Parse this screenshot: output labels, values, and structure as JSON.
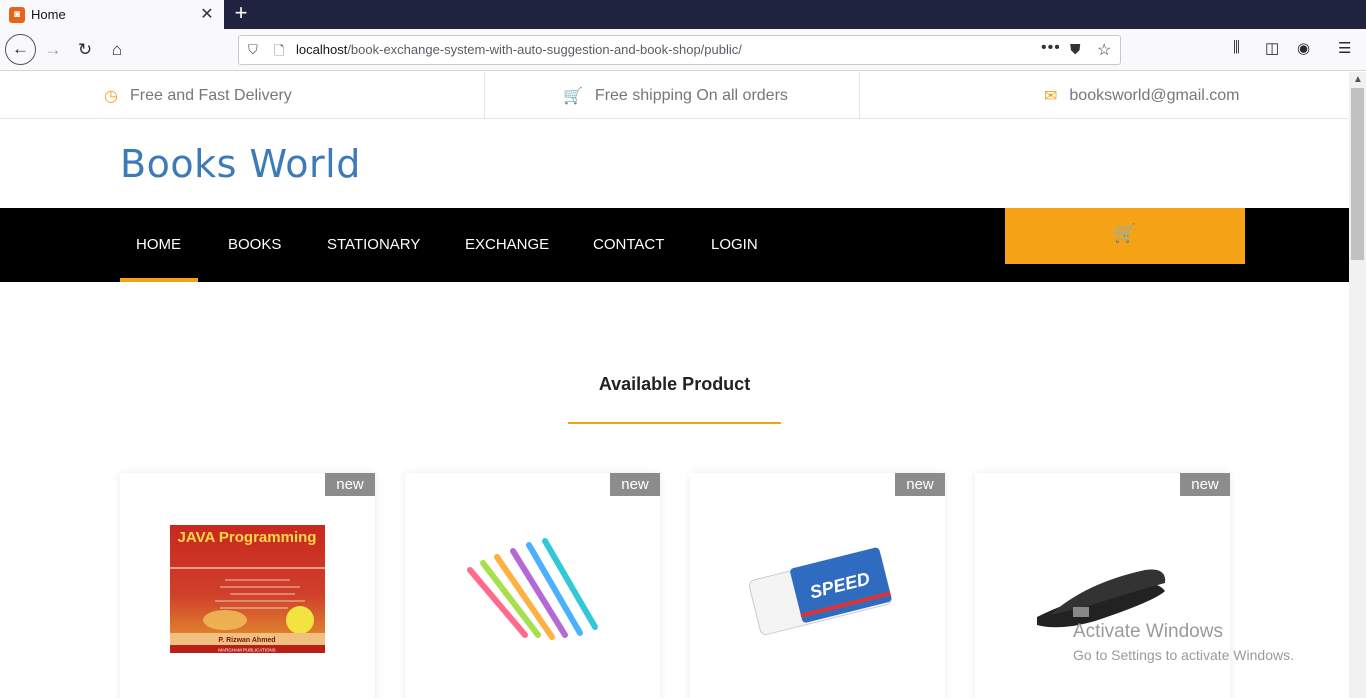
{
  "browser": {
    "tab_title": "Home",
    "url_host": "localhost",
    "url_path": "/book-exchange-system-with-auto-suggestion-and-book-shop/public/"
  },
  "topbar": {
    "delivery": "Free and Fast Delivery",
    "shipping": "Free shipping On all orders",
    "email": "booksworld@gmail.com"
  },
  "brand": "Books World",
  "nav": {
    "items": [
      "HOME",
      "BOOKS",
      "STATIONARY",
      "EXCHANGE",
      "CONTACT",
      "LOGIN"
    ],
    "active": "HOME"
  },
  "section": {
    "title": "Available Product"
  },
  "products": [
    {
      "badge": "new",
      "image": "java-programming-book-cover",
      "cover_title": "JAVA Programming",
      "cover_author": "P. Rizwan Ahmed",
      "cover_publisher": "MARGHAM PUBLICATIONS"
    },
    {
      "badge": "new",
      "image": "colored-pens"
    },
    {
      "badge": "new",
      "image": "eraser",
      "eraser_text": "SPEED"
    },
    {
      "badge": "new",
      "image": "stapler"
    }
  ],
  "watermark": {
    "title": "Activate Windows",
    "subtitle": "Go to Settings to activate Windows."
  },
  "colors": {
    "accent": "#f5a316",
    "brand": "#3d7ab8",
    "nav_bg": "#000000"
  }
}
